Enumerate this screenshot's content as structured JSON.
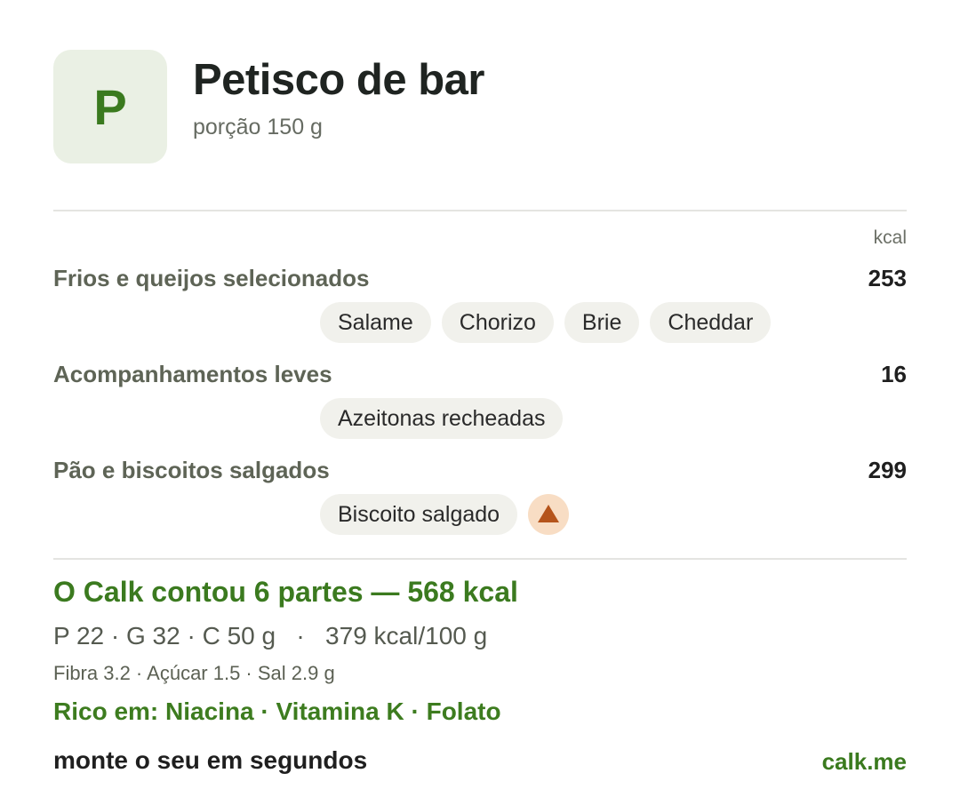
{
  "header": {
    "avatar_letter": "P",
    "title": "Petisco de bar",
    "subtitle": "porção 150 g"
  },
  "table": {
    "unit_label": "kcal",
    "groups": [
      {
        "name": "Frios e queijos selecionados",
        "kcal": "253",
        "items": [
          "Salame",
          "Chorizo",
          "Brie",
          "Cheddar"
        ]
      },
      {
        "name": "Acompanhamentos leves",
        "kcal": "16",
        "items": [
          "Azeitonas recheadas"
        ]
      },
      {
        "name": "Pão e biscoitos salgados",
        "kcal": "299",
        "items": [
          "Biscoito salgado"
        ],
        "warning_icon": "warning-triangle-icon"
      }
    ]
  },
  "summary": {
    "headline": "O Calk contou 6 partes — 568 kcal",
    "macros": "P 22 · G 32 · C 50 g   ·   379 kcal/100 g",
    "micros": "Fibra 3.2 · Açúcar 1.5 · Sal 2.9 g",
    "rich_in": "Rico em: Niacina · Vitamina K · Folato"
  },
  "footer": {
    "cta": "monte o seu em segundos",
    "link": "calk.me"
  },
  "colors": {
    "accent_green": "#3a7a1e",
    "avatar_bg": "#eaf0e4",
    "chip_bg": "#f1f1ec",
    "warning_bg": "#f8ddc4",
    "warning_fg": "#b5541b"
  }
}
